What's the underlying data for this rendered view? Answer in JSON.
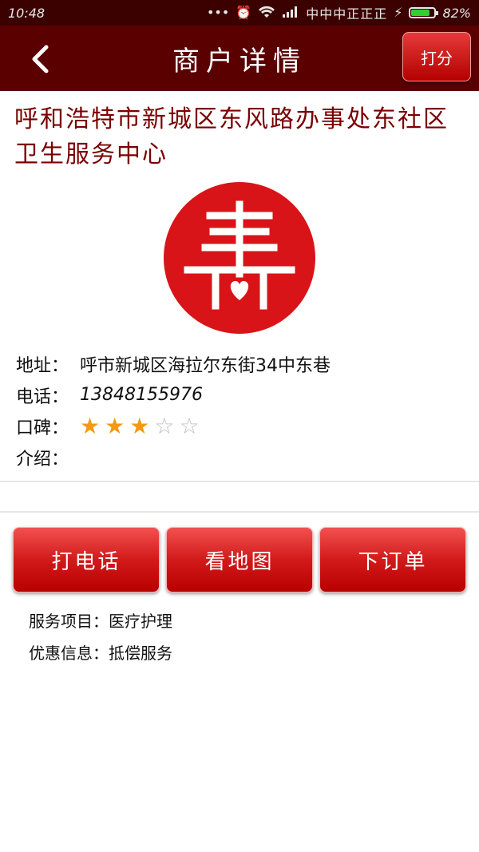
{
  "status_bar": {
    "time": "10:48",
    "carrier": "中中中正正正",
    "battery": "82%",
    "battery_level": 0.82
  },
  "header": {
    "title": "商户详情",
    "score_button": "打分"
  },
  "merchant": {
    "name": "呼和浩特市新城区东风路办事处东社区卫生服务中心",
    "address_label": "地址：",
    "address": "呼市新城区海拉尔东街34中东巷",
    "phone_label": "电话：",
    "phone": "13848155976",
    "rating_label": "口碑：",
    "rating": 3,
    "rating_max": 5,
    "intro_label": "介绍：",
    "intro": ""
  },
  "actions": {
    "call": "打电话",
    "map": "看地图",
    "order": "下订单"
  },
  "extra": {
    "service_items": "服务项目：医疗护理",
    "offers": "优惠信息：抵偿服务"
  },
  "colors": {
    "header_bg": "#5a0000",
    "accent_red": "#d21a1a",
    "title_red": "#7a0000",
    "star_orange": "#f39a12"
  }
}
